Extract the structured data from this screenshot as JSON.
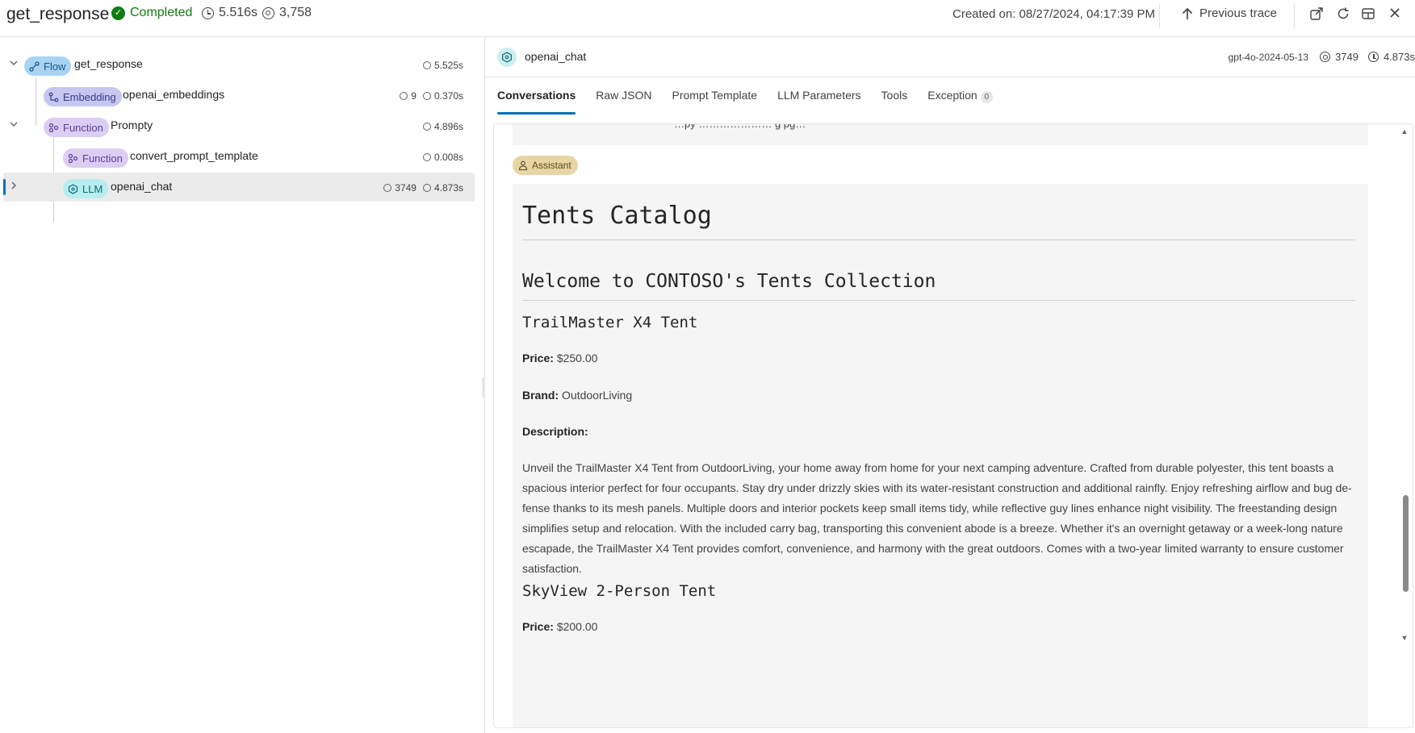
{
  "header": {
    "title": "get_response",
    "status": "Completed",
    "duration": "5.516s",
    "tokens": "3,758",
    "created": "Created on: 08/27/2024, 04:17:39 PM",
    "previous_trace": "Previous trace",
    "icons": [
      "share-icon",
      "refresh-icon",
      "layout-icon",
      "close-icon"
    ]
  },
  "tree": {
    "nodes": [
      {
        "kind": "Flow",
        "name": "get_response",
        "tokens": "",
        "duration": "5.525s"
      },
      {
        "kind": "Embedding",
        "name": "openai_embeddings",
        "tokens": "9",
        "duration": "0.370s"
      },
      {
        "kind": "Function",
        "name": "Prompty",
        "tokens": "",
        "duration": "4.896s"
      },
      {
        "kind": "Function",
        "name": "convert_prompt_template",
        "tokens": "",
        "duration": "0.008s"
      },
      {
        "kind": "LLM",
        "name": "openai_chat",
        "tokens": "3749",
        "duration": "4.873s"
      }
    ]
  },
  "detail": {
    "name": "openai_chat",
    "model": "gpt-4o-2024-05-13",
    "tokens": "3749",
    "duration": "4.873s",
    "tabs": [
      "Conversations",
      "Raw JSON",
      "Prompt Template",
      "LLM Parameters",
      "Tools",
      "Exception"
    ],
    "exception_count": "0",
    "previous_message_fragment": "…py ………………… g pg…",
    "role": "Assistant",
    "content": {
      "h1": "Tents Catalog",
      "h2": "Welcome to CONTOSO's Tents Collection",
      "product1": {
        "name": "TrailMaster X4 Tent",
        "price_label": "Price:",
        "price": "$250.00",
        "brand_label": "Brand:",
        "brand": "OutdoorLiving",
        "description_label": "Description:",
        "description": "Unveil the TrailMaster X4 Tent from OutdoorLiving, your home away from home for your next camping adventure. Crafted from durable polyester, this tent boasts a spacious interior perfect for four occupants. Stay dry under drizzly skies with its water-resistant construction and additional rainfly. Enjoy refreshing airflow and bug de-fense thanks to its mesh panels. Multiple doors and interior pockets keep small items tidy, while reflective guy lines enhance night visibility. The freestanding design simplifies setup and relocation. With the included carry bag, transporting this convenient abode is a breeze. Whether it's an overnight getaway or a week-long nature escapade, the TrailMaster X4 Tent provides comfort, convenience, and harmony with the great outdoors. Comes with a two-year limited warranty to ensure customer satisfaction."
      },
      "product2": {
        "name": "SkyView 2-Person Tent",
        "price_label": "Price:",
        "price": "$200.00"
      }
    }
  },
  "colors": {
    "completed": "#107c10",
    "accent": "#0f6cbd",
    "flow_badge": "#a9d3f2",
    "embedding_badge": "#c5c7f0",
    "function_badge": "#dccdf3",
    "llm_badge": "#b8ecee",
    "assistant_badge": "#e8d5a6"
  }
}
